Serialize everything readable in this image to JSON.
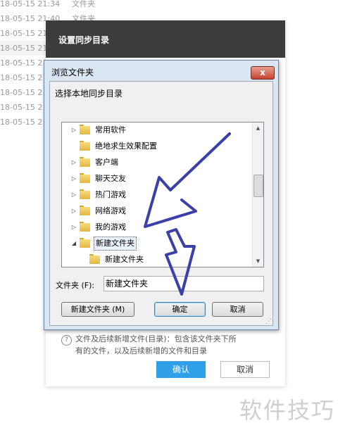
{
  "background_rows": [
    {
      "date": "18-05-15 21:34",
      "type": "文件夹"
    },
    {
      "date": "18-05-15 21:40",
      "type": "文件夹"
    },
    {
      "date": "18-05-15 21:",
      "type": ""
    },
    {
      "date": "18-05-15 21:",
      "type": ""
    },
    {
      "date": "18-05-15 2",
      "type": ""
    },
    {
      "date": "18-05-15 2",
      "type": ""
    },
    {
      "date": "18-05-15 2",
      "type": ""
    },
    {
      "date": "18-05-15 2",
      "type": ""
    },
    {
      "date": "18-05-15 2",
      "type": ""
    }
  ],
  "sync_dialog": {
    "title": "设置同步目录",
    "hint_icon": "?",
    "hint_line1": "文件及后续新增文件(目录)：包含该文件夹下所",
    "hint_line2": "有的文件，以及后续新增的文件和目录",
    "confirm_label": "确认",
    "cancel_label": "取消"
  },
  "browse_dialog": {
    "title": "浏览文件夹",
    "close_glyph": "x",
    "description": "选择本地同步目录",
    "tree": [
      {
        "label": "常用软件",
        "arrow": "▷"
      },
      {
        "label": "绝地求生效果配置",
        "arrow": ""
      },
      {
        "label": "客户端",
        "arrow": "▷"
      },
      {
        "label": "聊天交友",
        "arrow": "▷"
      },
      {
        "label": "热门游戏",
        "arrow": "▷"
      },
      {
        "label": "网络游戏",
        "arrow": "▷"
      },
      {
        "label": "我的游戏",
        "arrow": "▷"
      },
      {
        "label": "新建文件夹",
        "arrow": "◢",
        "selected": true
      },
      {
        "label": "新建文件夹",
        "arrow": ""
      }
    ],
    "folder_label": "文件夹 (F):",
    "folder_value": "新建文件夹",
    "new_folder_label": "新建文件夹 (M)",
    "ok_label": "确定",
    "cancel_label": "取消",
    "scroll_up": "▲",
    "scroll_down": "▼",
    "resize_grip": "⋰"
  },
  "annotation_color": "#3b3fa8",
  "watermark": "软件技巧"
}
